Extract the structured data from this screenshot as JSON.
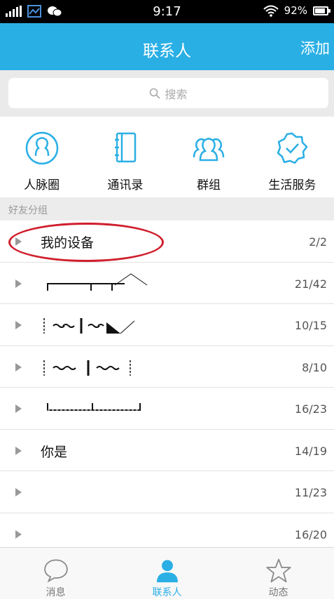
{
  "status_bar": {
    "time": "9:17",
    "battery": "92%"
  },
  "header": {
    "title": "联系人",
    "add_label": "添加"
  },
  "search": {
    "placeholder": "搜索"
  },
  "quick_actions": [
    {
      "label": "人脉圈",
      "icon": "person-circle-icon"
    },
    {
      "label": "通讯录",
      "icon": "address-book-icon"
    },
    {
      "label": "群组",
      "icon": "group-icon"
    },
    {
      "label": "生活服务",
      "icon": "badge-check-icon"
    }
  ],
  "groups_header": "好友分组",
  "groups": [
    {
      "name": "我的设备",
      "count": "2/2"
    },
    {
      "name": "",
      "count": "21/42"
    },
    {
      "name": "",
      "count": "10/15"
    },
    {
      "name": "",
      "count": "8/10"
    },
    {
      "name": "",
      "count": "16/23"
    },
    {
      "name": "你是",
      "count": "14/19"
    },
    {
      "name": "",
      "count": "11/23"
    },
    {
      "name": "",
      "count": "16/20"
    }
  ],
  "tabs": [
    {
      "label": "消息",
      "icon": "chat-bubble-icon",
      "active": false
    },
    {
      "label": "联系人",
      "icon": "contact-person-icon",
      "active": true
    },
    {
      "label": "动态",
      "icon": "star-icon",
      "active": false
    }
  ],
  "colors": {
    "accent": "#2aafe5",
    "annotation_red": "#d01f2d"
  }
}
